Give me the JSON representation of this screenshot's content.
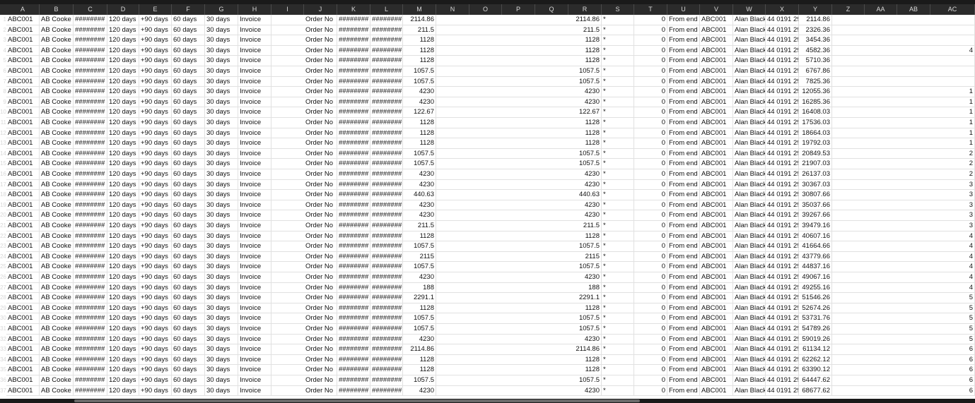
{
  "columns": [
    "A",
    "B",
    "C",
    "D",
    "E",
    "F",
    "G",
    "H",
    "I",
    "J",
    "K",
    "L",
    "M",
    "N",
    "O",
    "P",
    "Q",
    "R",
    "S",
    "T",
    "U",
    "V",
    "W",
    "X",
    "Y",
    "Z",
    "AA",
    "AB",
    "AC"
  ],
  "row_numbers": [
    "1",
    "2",
    "3",
    "4",
    "5",
    "6",
    "7",
    "8",
    "9",
    "10",
    "11",
    "12",
    "13",
    "14",
    "15",
    "16",
    "17",
    "18",
    "19",
    "20",
    "21",
    "22",
    "23",
    "24",
    "25",
    "26",
    "27",
    "28",
    "29",
    "30",
    "31",
    "32",
    "33",
    "34",
    "35",
    "36",
    "37"
  ],
  "common": {
    "a": "ABC001",
    "b": "AB Cooke",
    "c": "########",
    "d": "120 days",
    "e": "+90 days",
    "f": "60 days",
    "g": "30 days",
    "h": "Invoice",
    "j": "Order No",
    "k": "########",
    "l": "########",
    "s": "*",
    "t": "0",
    "u": "From end",
    "v": "ABC001",
    "w": "Alan Black",
    "x": "44 0191 29"
  },
  "rows": [
    {
      "m": "2114.86",
      "r": "2114.86",
      "y": "2114.86",
      "ac": ""
    },
    {
      "m": "211.5",
      "r": "211.5",
      "y": "2326.36",
      "ac": ""
    },
    {
      "m": "1128",
      "r": "1128",
      "y": "3454.36",
      "ac": ""
    },
    {
      "m": "1128",
      "r": "1128",
      "y": "4582.36",
      "ac": "4"
    },
    {
      "m": "1128",
      "r": "1128",
      "y": "5710.36",
      "ac": ""
    },
    {
      "m": "1057.5",
      "r": "1057.5",
      "y": "6767.86",
      "ac": ""
    },
    {
      "m": "1057.5",
      "r": "1057.5",
      "y": "7825.36",
      "ac": ""
    },
    {
      "m": "4230",
      "r": "4230",
      "y": "12055.36",
      "ac": "1"
    },
    {
      "m": "4230",
      "r": "4230",
      "y": "16285.36",
      "ac": "1"
    },
    {
      "m": "122.67",
      "r": "122.67",
      "y": "16408.03",
      "ac": "1"
    },
    {
      "m": "1128",
      "r": "1128",
      "y": "17536.03",
      "ac": "1"
    },
    {
      "m": "1128",
      "r": "1128",
      "y": "18664.03",
      "ac": "1"
    },
    {
      "m": "1128",
      "r": "1128",
      "y": "19792.03",
      "ac": "1"
    },
    {
      "m": "1057.5",
      "r": "1057.5",
      "y": "20849.53",
      "ac": "2"
    },
    {
      "m": "1057.5",
      "r": "1057.5",
      "y": "21907.03",
      "ac": "2"
    },
    {
      "m": "4230",
      "r": "4230",
      "y": "26137.03",
      "ac": "2"
    },
    {
      "m": "4230",
      "r": "4230",
      "y": "30367.03",
      "ac": "3"
    },
    {
      "m": "440.63",
      "r": "440.63",
      "y": "30807.66",
      "ac": "3"
    },
    {
      "m": "4230",
      "r": "4230",
      "y": "35037.66",
      "ac": "3"
    },
    {
      "m": "4230",
      "r": "4230",
      "y": "39267.66",
      "ac": "3"
    },
    {
      "m": "211.5",
      "r": "211.5",
      "y": "39479.16",
      "ac": "3"
    },
    {
      "m": "1128",
      "r": "1128",
      "y": "40607.16",
      "ac": "4"
    },
    {
      "m": "1057.5",
      "r": "1057.5",
      "y": "41664.66",
      "ac": "4"
    },
    {
      "m": "2115",
      "r": "2115",
      "y": "43779.66",
      "ac": "4"
    },
    {
      "m": "1057.5",
      "r": "1057.5",
      "y": "44837.16",
      "ac": "4"
    },
    {
      "m": "4230",
      "r": "4230",
      "y": "49067.16",
      "ac": "4"
    },
    {
      "m": "188",
      "r": "188",
      "y": "49255.16",
      "ac": "4"
    },
    {
      "m": "2291.1",
      "r": "2291.1",
      "y": "51546.26",
      "ac": "5"
    },
    {
      "m": "1128",
      "r": "1128",
      "y": "52674.26",
      "ac": "5"
    },
    {
      "m": "1057.5",
      "r": "1057.5",
      "y": "53731.76",
      "ac": "5"
    },
    {
      "m": "1057.5",
      "r": "1057.5",
      "y": "54789.26",
      "ac": "5"
    },
    {
      "m": "4230",
      "r": "4230",
      "y": "59019.26",
      "ac": "5"
    },
    {
      "m": "2114.86",
      "r": "2114.86",
      "y": "61134.12",
      "ac": "6"
    },
    {
      "m": "1128",
      "r": "1128",
      "y": "62262.12",
      "ac": "6"
    },
    {
      "m": "1128",
      "r": "1128",
      "y": "63390.12",
      "ac": "6"
    },
    {
      "m": "1057.5",
      "r": "1057.5",
      "y": "64447.62",
      "ac": "6"
    },
    {
      "m": "4230",
      "r": "4230",
      "y": "68677.62",
      "ac": "6"
    }
  ]
}
